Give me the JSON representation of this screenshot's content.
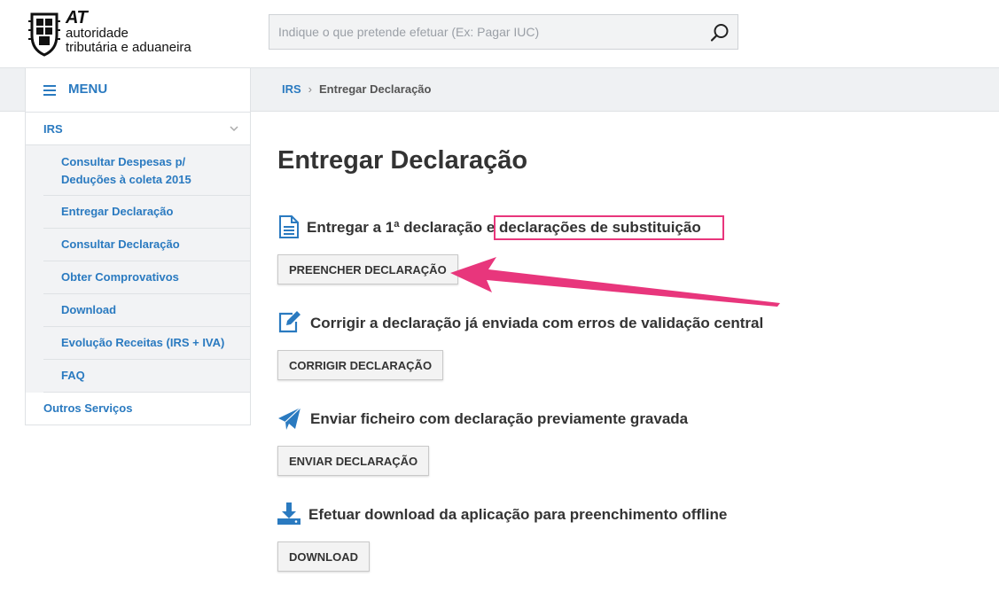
{
  "header": {
    "logo_at": "AT",
    "logo_line1": "autoridade",
    "logo_line2": "tributária e aduaneira",
    "search_placeholder": "Indique o que pretende efetuar (Ex: Pagar IUC)",
    "search_value": ""
  },
  "menu": {
    "label": "MENU"
  },
  "breadcrumb": {
    "items": [
      "IRS",
      "Entregar Declaração"
    ]
  },
  "sidebar": {
    "top": "IRS",
    "items": [
      "Consultar Despesas p/ Deduções à coleta 2015",
      "Entregar Declaração",
      "Consultar Declaração",
      "Obter Comprovativos",
      "Download",
      "Evolução Receitas (IRS + IVA)",
      "FAQ"
    ],
    "bottom": "Outros Serviços"
  },
  "main": {
    "title": "Entregar Declaração",
    "sections": [
      {
        "text": "Entregar a 1ª declaração e declarações de substituição",
        "button": "PREENCHER DECLARAÇÃO",
        "icon": "document-icon"
      },
      {
        "text": "Corrigir a declaração já enviada com erros de validação central",
        "button": "CORRIGIR DECLARAÇÃO",
        "icon": "edit-icon"
      },
      {
        "text": "Enviar ficheiro com declaração previamente gravada",
        "button": "ENVIAR DECLARAÇÃO",
        "icon": "paper-plane-icon"
      },
      {
        "text": "Efetuar download da aplicação para preenchimento offline",
        "button": "DOWNLOAD",
        "icon": "download-icon"
      }
    ]
  },
  "colors": {
    "link": "#2a7ac0",
    "annotation": "#e8367c",
    "bar": "#eff1f3"
  }
}
